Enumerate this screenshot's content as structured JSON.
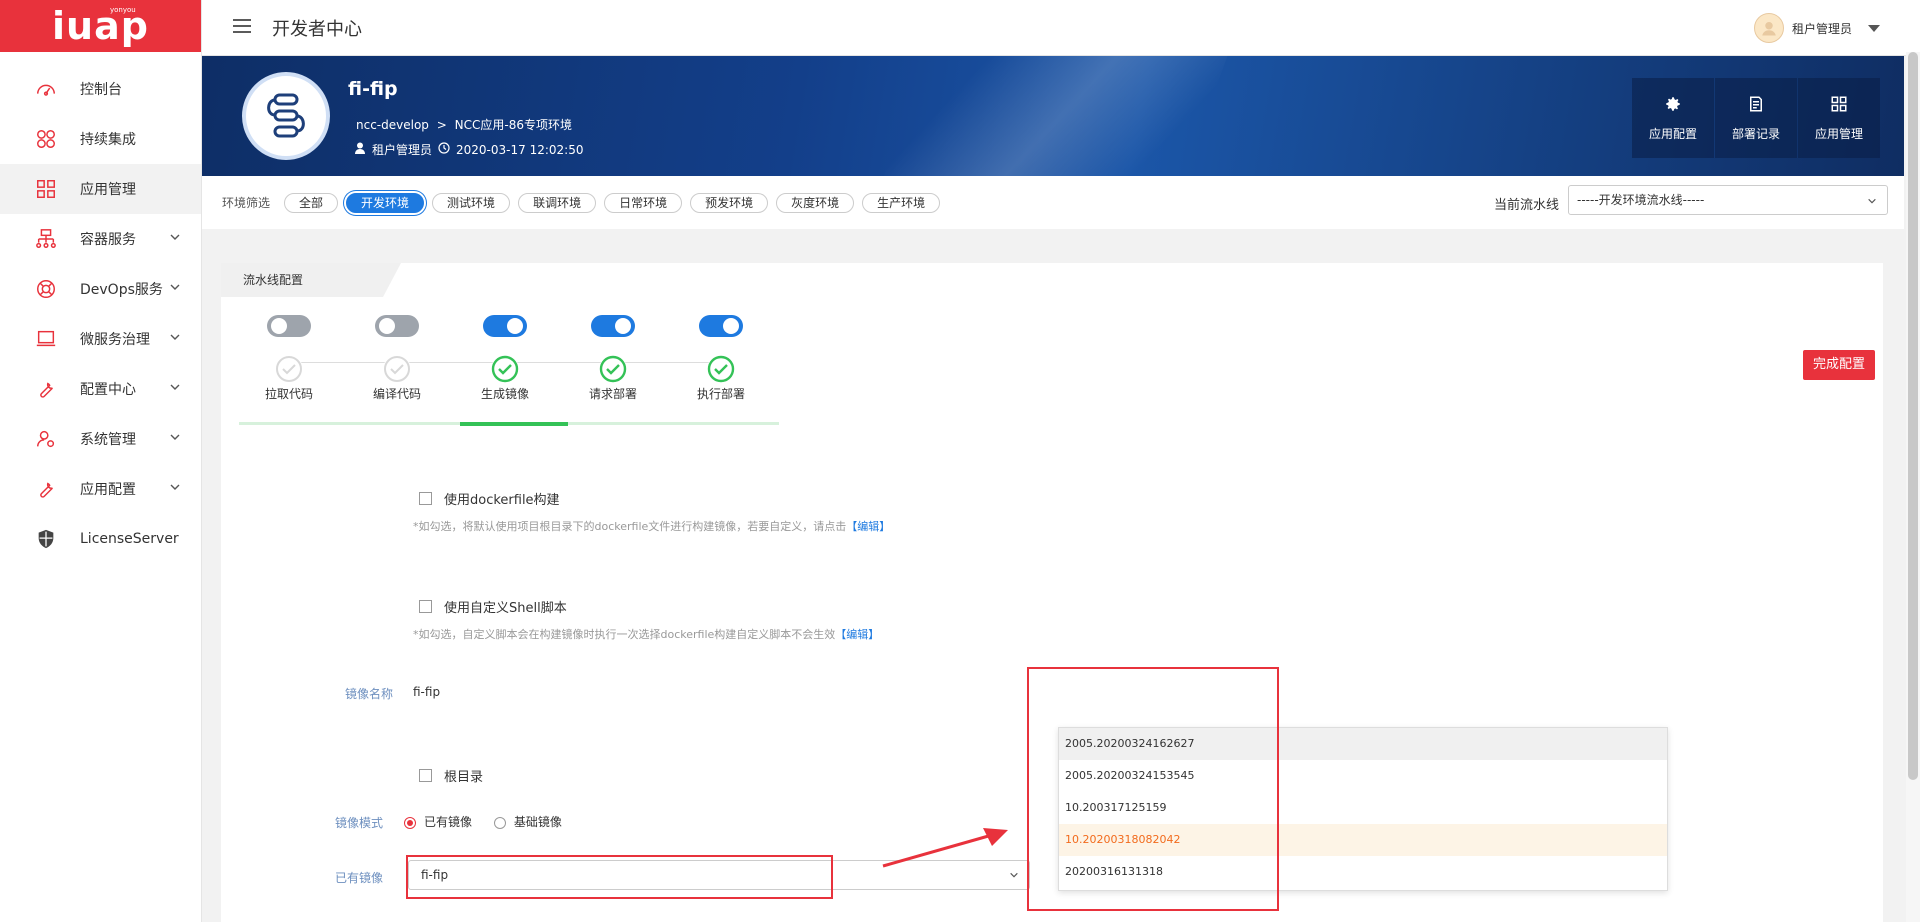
{
  "logo": {
    "text": "iuap",
    "sub": "yonyou"
  },
  "sidebar": {
    "items": [
      {
        "label": "控制台"
      },
      {
        "label": "持续集成"
      },
      {
        "label": "应用管理"
      },
      {
        "label": "容器服务"
      },
      {
        "label": "DevOps服务"
      },
      {
        "label": "微服务治理"
      },
      {
        "label": "配置中心"
      },
      {
        "label": "系统管理"
      },
      {
        "label": "应用配置"
      },
      {
        "label": "LicenseServer"
      }
    ]
  },
  "header": {
    "title": "开发者中心",
    "user": "租户管理员"
  },
  "app": {
    "name": "fi-fip",
    "crumb_a": "ncc-develop",
    "crumb_sep": ">",
    "crumb_b": "NCC应用-86专项环境",
    "owner": "租户管理员",
    "created": "2020-03-17 12:02:50"
  },
  "actions": [
    {
      "label": "应用配置"
    },
    {
      "label": "部署记录"
    },
    {
      "label": "应用管理"
    }
  ],
  "env_filter": {
    "label": "环境筛选",
    "chips": [
      "全部",
      "开发环境",
      "测试环境",
      "联调环境",
      "日常环境",
      "预发环境",
      "灰度环境",
      "生产环境"
    ],
    "active": "开发环境",
    "pipeline_label": "当前流水线",
    "pipeline_value": "-----开发环境流水线-----"
  },
  "pipeline": {
    "tab": "流水线配置",
    "finish_label": "完成配置",
    "steps": [
      {
        "label": "拉取代码",
        "enabled": false
      },
      {
        "label": "编译代码",
        "enabled": false
      },
      {
        "label": "生成镜像",
        "enabled": true
      },
      {
        "label": "请求部署",
        "enabled": true
      },
      {
        "label": "执行部署",
        "enabled": true
      }
    ]
  },
  "form": {
    "dockerfile_label": "使用dockerfile构建",
    "dockerfile_note": "*如勾选，将默认使用项目根目录下的dockerfile文件进行构建镜像，若要自定义，请点击",
    "shell_label": "使用自定义Shell脚本",
    "shell_note": "*如勾选，自定义脚本会在构建镜像时执行一次选择dockerfile构建自定义脚本不会生效",
    "edit_label": "【编辑】",
    "image_name_label": "镜像名称",
    "image_name_value": "fi-fip",
    "root_label": "根目录",
    "mode_label": "镜像模式",
    "mode_existing": "已有镜像",
    "mode_base": "基础镜像",
    "existing_label": "已有镜像",
    "existing_value": "fi-fip"
  },
  "tag_dropdown": {
    "options": [
      "2005.20200324162627",
      "2005.20200324153545",
      "10.200317125159",
      "10.20200318082042",
      "20200316131318"
    ],
    "hovered": "2005.20200324162627",
    "selected": "10.20200318082042"
  },
  "colors": {
    "brand_red": "#e8323c",
    "accent_blue": "#1e7ae0",
    "success_green": "#34c257"
  }
}
